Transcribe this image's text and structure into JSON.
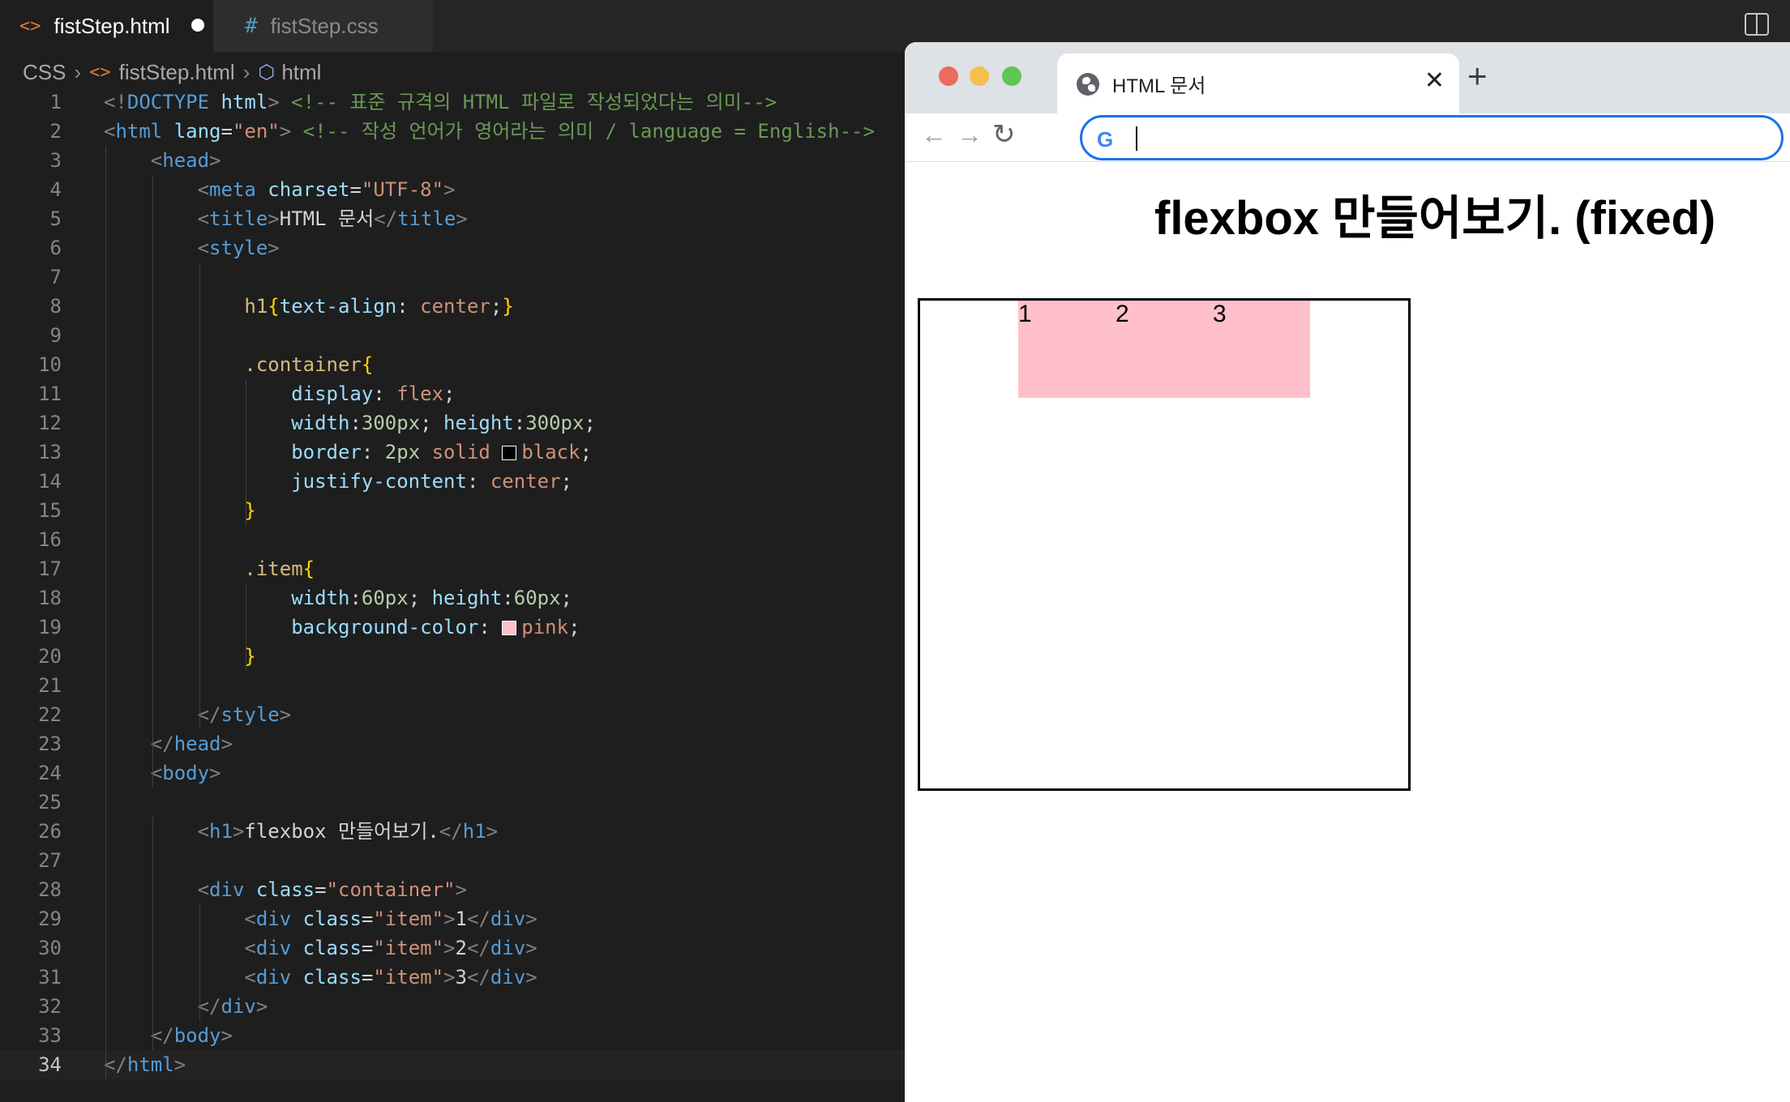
{
  "editor": {
    "tabs": [
      {
        "icon": "<>",
        "label": "fistStep.html"
      },
      {
        "icon": "#",
        "label": "fistStep.css"
      }
    ],
    "breadcrumb": [
      "CSS",
      "fistStep.html",
      "html"
    ],
    "active_line": "34"
  },
  "code": [
    {
      "n": "1",
      "html": "<span class='c-br'>&lt;!</span><span class='c-tag'>DOCTYPE</span> <span class='c-attr'>html</span><span class='c-br'>&gt;</span> <span class='c-com'>&lt;!-- 표준 규격의 HTML 파일로 작성되었다는 의미--&gt;</span>"
    },
    {
      "n": "2",
      "html": "<span class='c-br'>&lt;</span><span class='c-tag'>html</span> <span class='c-attr'>lang</span>=<span class='c-str'>\"en\"</span><span class='c-br'>&gt;</span> <span class='c-com'>&lt;!-- 작성 언어가 영어라는 의미 / language = English--&gt;</span>"
    },
    {
      "n": "3",
      "html": "    <span class='c-br'>&lt;</span><span class='c-tag'>head</span><span class='c-br'>&gt;</span>"
    },
    {
      "n": "4",
      "html": "        <span class='c-br'>&lt;</span><span class='c-tag'>meta</span> <span class='c-attr'>charset</span>=<span class='c-str'>\"UTF-8\"</span><span class='c-br'>&gt;</span>"
    },
    {
      "n": "5",
      "html": "        <span class='c-br'>&lt;</span><span class='c-tag'>title</span><span class='c-br'>&gt;</span><span class='c-txt'>HTML 문서</span><span class='c-br'>&lt;/</span><span class='c-tag'>title</span><span class='c-br'>&gt;</span>"
    },
    {
      "n": "6",
      "html": "        <span class='c-br'>&lt;</span><span class='c-tag'>style</span><span class='c-br'>&gt;</span>"
    },
    {
      "n": "7",
      "html": ""
    },
    {
      "n": "8",
      "html": "            <span class='c-sel'>h1</span><span class='c-brace'>{</span><span class='c-prop'>text-align</span>: <span class='c-val'>center</span>;<span class='c-brace'>}</span>"
    },
    {
      "n": "9",
      "html": ""
    },
    {
      "n": "10",
      "html": "            <span class='c-sel'>.container</span><span class='c-brace'>{</span>"
    },
    {
      "n": "11",
      "html": "                <span class='c-prop'>display</span>: <span class='c-val'>flex</span>;"
    },
    {
      "n": "12",
      "html": "                <span class='c-prop'>width</span>:<span class='c-num'>300px</span>; <span class='c-prop'>height</span>:<span class='c-num'>300px</span>;"
    },
    {
      "n": "13",
      "html": "                <span class='c-prop'>border</span>: <span class='c-num'>2px</span> <span class='c-val'>solid</span> <span class='swatch' style='background:#000000'></span><span class='c-val'>black</span>;"
    },
    {
      "n": "14",
      "html": "                <span class='c-prop'>justify-content</span>: <span class='c-val'>center</span>;"
    },
    {
      "n": "15",
      "html": "            <span class='c-brace'>}</span>"
    },
    {
      "n": "16",
      "html": ""
    },
    {
      "n": "17",
      "html": "            <span class='c-sel'>.item</span><span class='c-brace'>{</span>"
    },
    {
      "n": "18",
      "html": "                <span class='c-prop'>width</span>:<span class='c-num'>60px</span>; <span class='c-prop'>height</span>:<span class='c-num'>60px</span>;"
    },
    {
      "n": "19",
      "html": "                <span class='c-prop'>background-color</span>: <span class='swatch' style='background:#ffc0cb'></span><span class='c-val'>pink</span>;"
    },
    {
      "n": "20",
      "html": "            <span class='c-brace'>}</span>"
    },
    {
      "n": "21",
      "html": ""
    },
    {
      "n": "22",
      "html": "        <span class='c-br'>&lt;/</span><span class='c-tag'>style</span><span class='c-br'>&gt;</span>"
    },
    {
      "n": "23",
      "html": "    <span class='c-br'>&lt;/</span><span class='c-tag'>head</span><span class='c-br'>&gt;</span>"
    },
    {
      "n": "24",
      "html": "    <span class='c-br'>&lt;</span><span class='c-tag'>body</span><span class='c-br'>&gt;</span>"
    },
    {
      "n": "25",
      "html": ""
    },
    {
      "n": "26",
      "html": "        <span class='c-br'>&lt;</span><span class='c-tag'>h1</span><span class='c-br'>&gt;</span><span class='c-txt'>flexbox 만들어보기.</span><span class='c-br'>&lt;/</span><span class='c-tag'>h1</span><span class='c-br'>&gt;</span>"
    },
    {
      "n": "27",
      "html": ""
    },
    {
      "n": "28",
      "html": "        <span class='c-br'>&lt;</span><span class='c-tag'>div</span> <span class='c-attr'>class</span>=<span class='c-str'>\"container\"</span><span class='c-br'>&gt;</span>"
    },
    {
      "n": "29",
      "html": "            <span class='c-br'>&lt;</span><span class='c-tag'>div</span> <span class='c-attr'>class</span>=<span class='c-str'>\"item\"</span><span class='c-br'>&gt;</span><span class='c-txt'>1</span><span class='c-br'>&lt;/</span><span class='c-tag'>div</span><span class='c-br'>&gt;</span>"
    },
    {
      "n": "30",
      "html": "            <span class='c-br'>&lt;</span><span class='c-tag'>div</span> <span class='c-attr'>class</span>=<span class='c-str'>\"item\"</span><span class='c-br'>&gt;</span><span class='c-txt'>2</span><span class='c-br'>&lt;/</span><span class='c-tag'>div</span><span class='c-br'>&gt;</span>"
    },
    {
      "n": "31",
      "html": "            <span class='c-br'>&lt;</span><span class='c-tag'>div</span> <span class='c-attr'>class</span>=<span class='c-str'>\"item\"</span><span class='c-br'>&gt;</span><span class='c-txt'>3</span><span class='c-br'>&lt;/</span><span class='c-tag'>div</span><span class='c-br'>&gt;</span>"
    },
    {
      "n": "32",
      "html": "        <span class='c-br'>&lt;/</span><span class='c-tag'>div</span><span class='c-br'>&gt;</span>"
    },
    {
      "n": "33",
      "html": "    <span class='c-br'>&lt;/</span><span class='c-tag'>body</span><span class='c-br'>&gt;</span>"
    },
    {
      "n": "34",
      "html": "<span class='c-br'>&lt;/</span><span class='c-tag'>html</span><span class='c-br'>&gt;</span>"
    }
  ],
  "browser": {
    "tab_title": "HTML 문서",
    "tab_close": "✕",
    "new_tab": "+",
    "back": "←",
    "forward": "→",
    "reload": "↻",
    "omnibox_icon": "G",
    "omnibox_value": ""
  },
  "page": {
    "h1": "flexbox 만들어보기. (fixed)",
    "items": [
      "1",
      "2",
      "3"
    ],
    "item_color": "#ffc0cb",
    "border_color": "#000000"
  }
}
